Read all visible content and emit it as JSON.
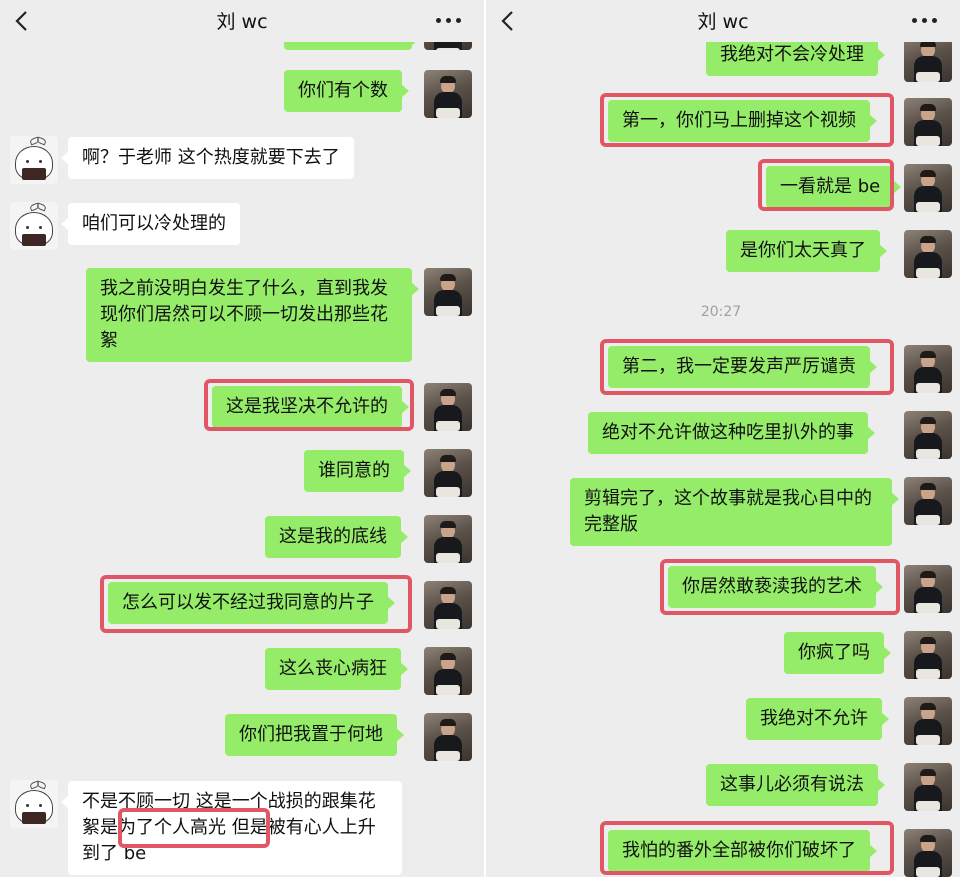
{
  "left": {
    "title": "刘 wc",
    "messages": [
      {
        "text": "你们有个数"
      },
      {
        "text": "啊？于老师 这个热度就要下去了"
      },
      {
        "text": "咱们可以冷处理的"
      },
      {
        "text": "我之前没明白发生了什么，直到我发现你们居然可以不顾一切发出那些花絮"
      },
      {
        "text": "这是我坚决不允许的"
      },
      {
        "text": "谁同意的"
      },
      {
        "text": "这是我的底线"
      },
      {
        "text": "怎么可以发不经过我同意的片子"
      },
      {
        "text": "这么丧心病狂"
      },
      {
        "text": "你们把我置于何地"
      },
      {
        "text": "不是不顾一切 这是一个战损的跟集花絮是为了个人高光 但是被有心人上升到了 be"
      }
    ]
  },
  "right": {
    "title": "刘 wc",
    "timestamp": "20:27",
    "messages": [
      {
        "text": "我绝对不会冷处理"
      },
      {
        "text": "第一，你们马上删掉这个视频"
      },
      {
        "text": "一看就是 be"
      },
      {
        "text": "是你们太天真了"
      },
      {
        "text": "第二，我一定要发声严厉谴责"
      },
      {
        "text": "绝对不允许做这种吃里扒外的事"
      },
      {
        "text": "剪辑完了，这个故事就是我心目中的完整版"
      },
      {
        "text": "你居然敢亵渎我的艺术"
      },
      {
        "text": "你疯了吗"
      },
      {
        "text": "我绝对不允许"
      },
      {
        "text": "这事儿必须有说法"
      },
      {
        "text": "我怕的番外全部被你们破坏了"
      }
    ]
  },
  "colors": {
    "my_bubble": "#95ec69",
    "other_bubble": "#ffffff",
    "highlight_box": "#e15665",
    "background": "#ededed"
  },
  "icons": [
    "back-arrow-icon",
    "more-dots-icon"
  ]
}
